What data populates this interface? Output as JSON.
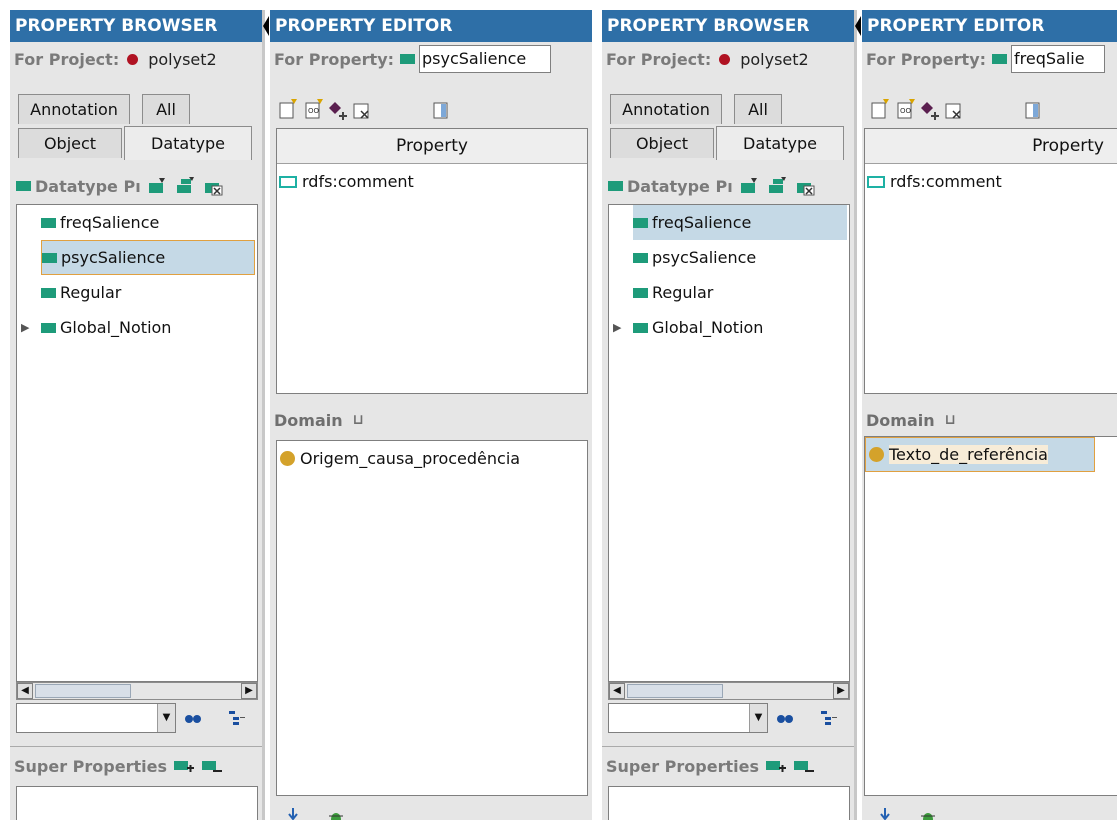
{
  "left": {
    "browser": {
      "header": "PROPERTY BROWSER",
      "project_label": "For Project:",
      "project_name": "polyset2",
      "tabs_row1": [
        "Annotation",
        "All"
      ],
      "tabs_row2": [
        "Object",
        "Datatype"
      ],
      "section_title": "Datatype Pı",
      "items": [
        "freqSalience",
        "psycSalience",
        "Regular",
        "Global_Notion"
      ],
      "selected_index": 1,
      "super_properties": "Super Properties"
    },
    "editor": {
      "header": "PROPERTY EDITOR",
      "property_label": "For Property:",
      "property_value": "psycSalience",
      "column_header": "Property",
      "properties": [
        "rdfs:comment"
      ],
      "domain_label": "Domain",
      "domain_items": [
        "Origem_causa_procedência"
      ]
    }
  },
  "right": {
    "browser": {
      "header": "PROPERTY BROWSER",
      "project_label": "For Project:",
      "project_name": "polyset2",
      "tabs_row1": [
        "Annotation",
        "All"
      ],
      "tabs_row2": [
        "Object",
        "Datatype"
      ],
      "section_title": "Datatype Pı",
      "items": [
        "freqSalience",
        "psycSalience",
        "Regular",
        "Global_Notion"
      ],
      "selected_index": 0,
      "super_properties": "Super Properties"
    },
    "editor": {
      "header": "PROPERTY EDITOR",
      "property_label": "For Property:",
      "property_value": "freqSalie",
      "column_header": "Property",
      "properties": [
        "rdfs:comment"
      ],
      "domain_label": "Domain",
      "domain_items": [
        "Texto_de_referência"
      ]
    }
  },
  "colors": {
    "header_bg": "#2e6fa7",
    "selection": "#c5d9e6",
    "datatype_green": "#1e9b7a",
    "class_gold": "#d4a22b",
    "project_red": "#b01222"
  }
}
